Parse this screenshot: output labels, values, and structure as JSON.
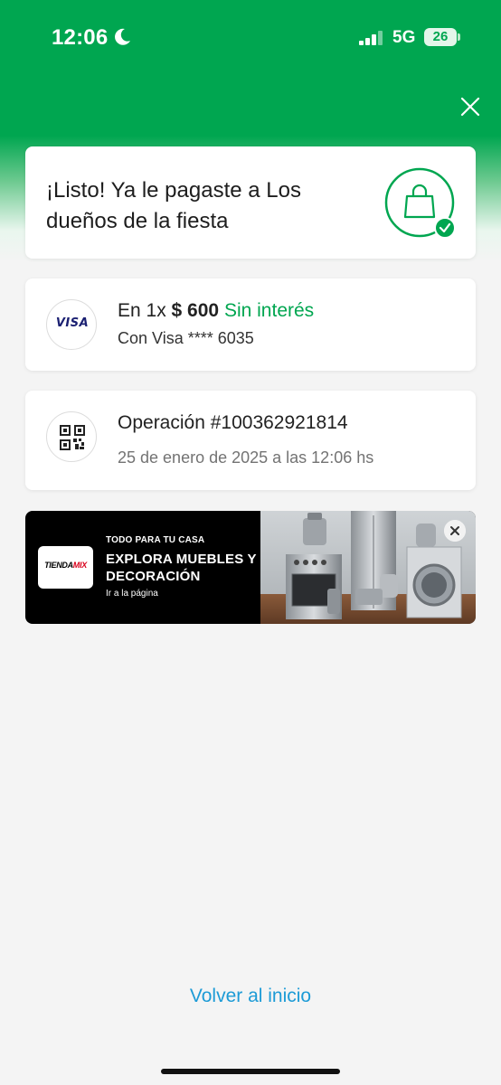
{
  "status_bar": {
    "time": "12:06",
    "network": "5G",
    "battery": "26"
  },
  "success": {
    "title": "¡Listo! Ya le pagaste a Los dueños de la fiesta",
    "icon": "shopping-bag-check-icon"
  },
  "payment": {
    "installments": "En 1x",
    "amount": "$ 600",
    "interest": "Sin interés",
    "card": "Con Visa **** 6035",
    "card_brand": "VISA"
  },
  "operation": {
    "number": "Operación #100362921814",
    "date": "25 de enero de 2025 a las 12:06 hs"
  },
  "banner": {
    "logo_a": "TIENDA",
    "logo_b": "MIX",
    "kicker": "TODO PARA TU CASA",
    "title": "EXPLORA MUEBLES Y DECORACIÓN",
    "link": "Ir a la página"
  },
  "footer": {
    "back_label": "Volver al inicio"
  },
  "colors": {
    "brand_green": "#00a650",
    "link_blue": "#1d9bd6"
  }
}
